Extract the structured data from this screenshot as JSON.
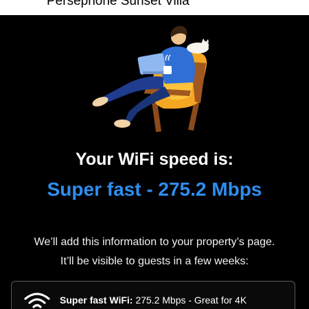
{
  "header": {
    "title": "Persephone Sunset Villa"
  },
  "illustration": {
    "icon": "person-in-armchair-with-laptop-illustration"
  },
  "result": {
    "heading": "Your WiFi speed is:",
    "speed_text": "Super fast - 275.2 Mbps"
  },
  "info": {
    "line1": "We’ll add this information to your property’s page.",
    "line2": "It’ll be visible to guests in a few weeks:"
  },
  "card": {
    "icon": "wifi-icon",
    "label": "Super fast WiFi:",
    "detail": " 275.2 Mbps - Great for 4K"
  },
  "colors": {
    "background": "#000000",
    "accent": "#2e8ef0",
    "text": "#ffffff"
  }
}
